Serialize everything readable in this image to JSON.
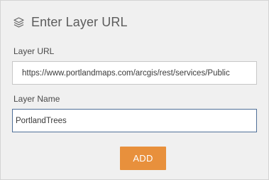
{
  "header": {
    "icon": "layers-icon",
    "title": "Enter Layer URL"
  },
  "form": {
    "layer_url": {
      "label": "Layer URL",
      "value": "https://www.portlandmaps.com/arcgis/rest/services/Public"
    },
    "layer_name": {
      "label": "Layer Name",
      "value": "PortlandTrees"
    }
  },
  "actions": {
    "add_label": "ADD"
  },
  "colors": {
    "panel_background": "#f0f0f0",
    "title_text": "#5c5c5c",
    "add_button": "#e8903c",
    "focused_border": "#4f6f98"
  }
}
